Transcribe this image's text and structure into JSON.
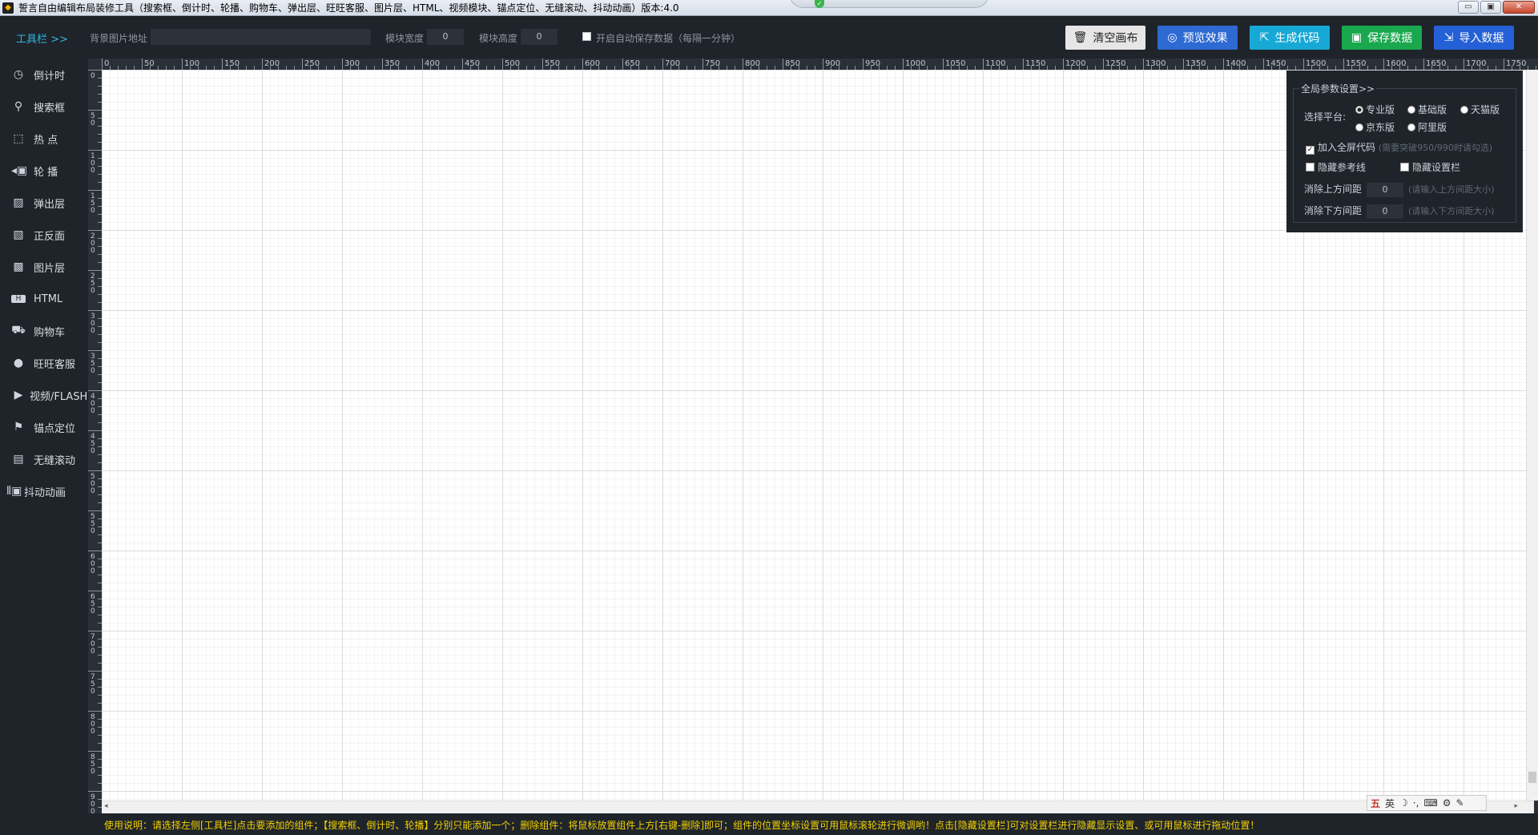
{
  "window": {
    "title": "誓言自由编辑布局装修工具（搜索框、倒计时、轮播、购物车、弹出层、旺旺客服、图片层、HTML、视频模块、锚点定位、无缝滚动、抖动动画）版本:4.0",
    "controls": [
      "minimize",
      "maximize",
      "close"
    ]
  },
  "toolbar": {
    "tools_label": "工具栏 >>",
    "bg_image_label": "背景图片地址",
    "bg_image_value": "",
    "width_label": "模块宽度",
    "width_value": "0",
    "height_label": "模块高度",
    "height_value": "0",
    "autosave_label": "开启自动保存数据（每隔一分钟）",
    "buttons": [
      {
        "label": "清空画布",
        "color": "#e6e6e6",
        "text_color": "#222222",
        "icon": "trash-icon"
      },
      {
        "label": "预览效果",
        "color": "#2d6ad3",
        "text_color": "#ffffff",
        "icon": "preview-icon"
      },
      {
        "label": "生成代码",
        "color": "#17a9d6",
        "text_color": "#ffffff",
        "icon": "export-icon"
      },
      {
        "label": "保存数据",
        "color": "#1aa84f",
        "text_color": "#ffffff",
        "icon": "save-icon"
      },
      {
        "label": "导入数据",
        "color": "#2460d6",
        "text_color": "#ffffff",
        "icon": "import-icon"
      }
    ]
  },
  "sidebar": {
    "items": [
      {
        "label": "倒计时",
        "icon": "clock-icon"
      },
      {
        "label": "搜索框",
        "icon": "search-icon"
      },
      {
        "label": "热 点",
        "icon": "hotspot-icon"
      },
      {
        "label": "轮 播",
        "icon": "carousel-icon"
      },
      {
        "label": "弹出层",
        "icon": "popup-icon"
      },
      {
        "label": "正反面",
        "icon": "flip-icon"
      },
      {
        "label": "图片层",
        "icon": "image-icon"
      },
      {
        "label": "HTML",
        "icon": "html-icon"
      },
      {
        "label": "购物车",
        "icon": "cart-icon"
      },
      {
        "label": "旺旺客服",
        "icon": "chat-icon"
      },
      {
        "label": "视频/FLASH",
        "icon": "play-icon"
      },
      {
        "label": "锚点定位",
        "icon": "pin-icon"
      },
      {
        "label": "无缝滚动",
        "icon": "scroll-icon"
      },
      {
        "label": "抖动动画",
        "icon": "shake-icon"
      }
    ]
  },
  "ruler": {
    "top_ticks": [
      "0",
      "50",
      "100",
      "150",
      "200",
      "250",
      "300",
      "350",
      "400",
      "450",
      "500",
      "550",
      "600",
      "650",
      "700",
      "750",
      "800",
      "850",
      "900",
      "950",
      "1000",
      "1050",
      "1100",
      "1150",
      "1200",
      "1250",
      "1300",
      "1350",
      "1400",
      "1450",
      "1500",
      "1550",
      "1600",
      "1650",
      "1700",
      "1750"
    ],
    "left_ticks": [
      "0",
      "50",
      "100",
      "150",
      "200",
      "250",
      "300",
      "350",
      "400",
      "450",
      "500",
      "550",
      "600",
      "650",
      "700",
      "750",
      "800",
      "850",
      "900"
    ]
  },
  "panel": {
    "title": "全局参数设置>>",
    "platform_label": "选择平台:",
    "platforms": [
      {
        "label": "专业版",
        "selected": true
      },
      {
        "label": "基础版",
        "selected": false
      },
      {
        "label": "天猫版",
        "selected": false
      },
      {
        "label": "京东版",
        "selected": false
      },
      {
        "label": "阿里版",
        "selected": false
      }
    ],
    "fullscreen_label": "加入全屏代码",
    "fullscreen_hint": "(需要突破950/990时请勾选)",
    "fullscreen_checked": true,
    "hide_guides_label": "隐藏参考线",
    "hide_settings_label": "隐藏设置栏",
    "top_gap_label": "消除上方间距",
    "top_gap_value": "0",
    "top_gap_hint": "(请输入上方间距大小)",
    "bottom_gap_label": "消除下方间距",
    "bottom_gap_value": "0",
    "bottom_gap_hint": "(请输入下方间距大小)"
  },
  "ime": {
    "label": "英"
  },
  "status": {
    "text": "使用说明：请选择左侧[工具栏]点击要添加的组件；【搜索框、倒计时、轮播】分别只能添加一个；删除组件：将鼠标放置组件上方[右键-删除]即可；组件的位置坐标设置可用鼠标滚轮进行微调哟！点击[隐藏设置栏]可对设置栏进行隐藏显示设置、或可用鼠标进行拖动位置！"
  }
}
